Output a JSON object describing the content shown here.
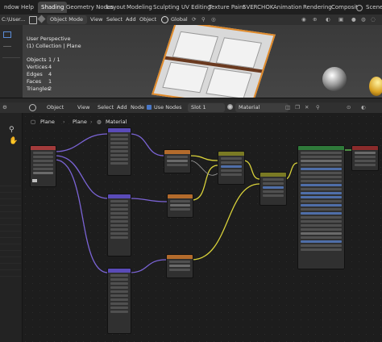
{
  "topbar": {
    "menu_window": "ndow",
    "menu_help": "Help",
    "tabs": [
      "Shading",
      "Geometry Nodes",
      "Layout",
      "Modeling",
      "Sculpting",
      "UV Editing",
      "Texture Paint",
      "SVERCHOK",
      "Animation",
      "Rendering",
      "Composit"
    ],
    "scene_label": "Scene"
  },
  "viewport_header": {
    "path": "C:\\User...",
    "mode": "Object Mode",
    "menus": [
      "View",
      "Select",
      "Add",
      "Object"
    ],
    "transform": "Global"
  },
  "viewport": {
    "perspective": "User Perspective",
    "collection": "(1) Collection | Plane",
    "stats": [
      {
        "label": "Objects",
        "value": "1 / 1"
      },
      {
        "label": "Vertices",
        "value": "4"
      },
      {
        "label": "Edges",
        "value": "4"
      },
      {
        "label": "Faces",
        "value": "1"
      },
      {
        "label": "Triangles",
        "value": "2"
      }
    ]
  },
  "node_header": {
    "editor_type": "Object",
    "menus": [
      "View",
      "Select",
      "Add",
      "Node"
    ],
    "use_nodes": "Use Nodes",
    "slot": "Slot 1",
    "material": "Material"
  },
  "breadcrumb": [
    "Plane",
    "Plane",
    "Material"
  ],
  "colors": {
    "texcoord_head": "#a33b3b",
    "mapping_head": "#5a4bb8",
    "image_head": "#b36b2c",
    "shader_head": "#2f7a3a",
    "mix_head": "#7a7a24",
    "output_head": "#8a2b2b",
    "wire_purple": "#7b64d6",
    "wire_yellow": "#d9d23a",
    "wire_grey": "#9a9a9a"
  }
}
